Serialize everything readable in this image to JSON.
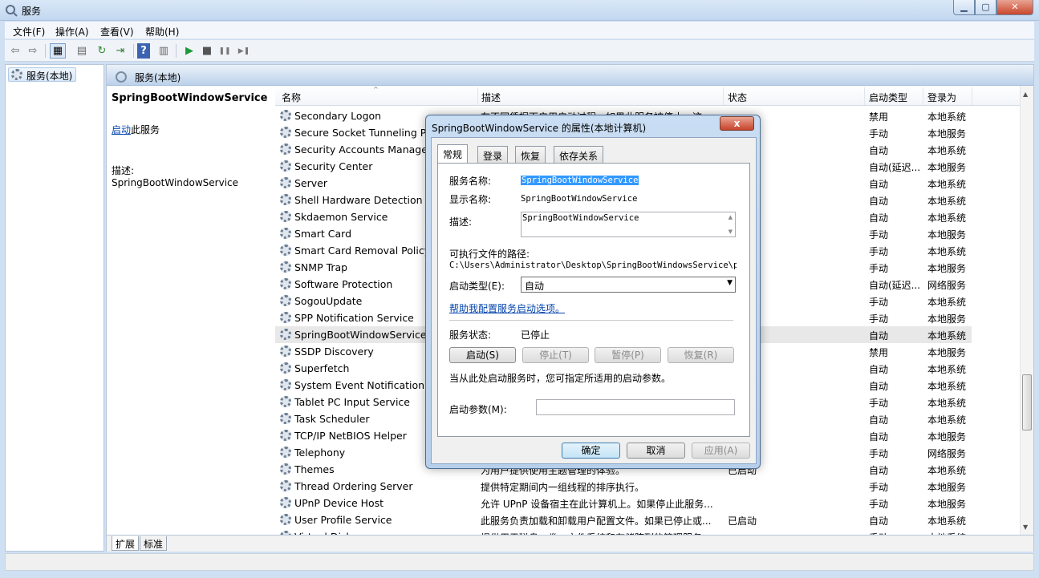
{
  "window": {
    "title": "服务",
    "controls": [
      "minimize",
      "maximize",
      "close"
    ]
  },
  "menu": [
    "文件(F)",
    "操作(A)",
    "查看(V)",
    "帮助(H)"
  ],
  "toolbar": {
    "icons": [
      "back-icon",
      "forward-icon",
      "console-tree-icon",
      "properties-icon",
      "refresh-icon",
      "export-icon",
      "help-icon",
      "view-icon",
      "play-icon",
      "stop-icon",
      "pause-icon",
      "resume-icon"
    ],
    "glyphs": {
      "back": "⇦",
      "forward": "⇨",
      "tree": "▦",
      "props": "▤",
      "refresh": "↻",
      "export": "⇥",
      "help": "?",
      "view": "▥",
      "play": "▶",
      "stop": "■",
      "pause": "❚❚",
      "resume": "▶❚"
    }
  },
  "tree": {
    "node_label": "服务(本地)"
  },
  "pane": {
    "header": "服务(本地)",
    "detail": {
      "service_title": "SpringBootWindowService",
      "start_link": "启动",
      "start_rest": "此服务",
      "desc_label": "描述:",
      "desc_text": "SpringBootWindowService"
    },
    "columns": [
      "名称",
      "描述",
      "状态",
      "启动类型",
      "登录为"
    ],
    "sort_indicator": "^",
    "rows": [
      {
        "name": "Secondary Logon",
        "desc": "在不同凭据下启用启动过程。如果此服务被停止，这...",
        "status": "",
        "type": "禁用",
        "logon": "本地系统"
      },
      {
        "name": "Secure Socket Tunneling Protocol Service",
        "desc": "",
        "status": "",
        "type": "手动",
        "logon": "本地服务"
      },
      {
        "name": "Security Accounts Manager",
        "desc": "",
        "status": "",
        "type": "自动",
        "logon": "本地系统"
      },
      {
        "name": "Security Center",
        "desc": "",
        "status": "",
        "type": "自动(延迟...",
        "logon": "本地服务"
      },
      {
        "name": "Server",
        "desc": "",
        "status": "",
        "type": "自动",
        "logon": "本地系统"
      },
      {
        "name": "Shell Hardware Detection",
        "desc": "",
        "status": "",
        "type": "自动",
        "logon": "本地系统"
      },
      {
        "name": "Skdaemon Service",
        "desc": "",
        "status": "",
        "type": "自动",
        "logon": "本地系统"
      },
      {
        "name": "Smart Card",
        "desc": "",
        "status": "",
        "type": "手动",
        "logon": "本地服务"
      },
      {
        "name": "Smart Card Removal Policy",
        "desc": "",
        "status": "",
        "type": "手动",
        "logon": "本地系统"
      },
      {
        "name": "SNMP Trap",
        "desc": "",
        "status": "",
        "type": "手动",
        "logon": "本地服务"
      },
      {
        "name": "Software Protection",
        "desc": "",
        "status": "",
        "type": "自动(延迟...",
        "logon": "网络服务"
      },
      {
        "name": "SogouUpdate",
        "desc": "",
        "status": "",
        "type": "手动",
        "logon": "本地系统"
      },
      {
        "name": "SPP Notification Service",
        "desc": "",
        "status": "",
        "type": "手动",
        "logon": "本地服务"
      },
      {
        "name": "SpringBootWindowService",
        "desc": "",
        "status": "",
        "type": "自动",
        "logon": "本地系统"
      },
      {
        "name": "SSDP Discovery",
        "desc": "",
        "status": "",
        "type": "禁用",
        "logon": "本地服务"
      },
      {
        "name": "Superfetch",
        "desc": "",
        "status": "",
        "type": "自动",
        "logon": "本地系统"
      },
      {
        "name": "System Event Notification Service",
        "desc": "",
        "status": "",
        "type": "自动",
        "logon": "本地系统"
      },
      {
        "name": "Tablet PC Input Service",
        "desc": "",
        "status": "",
        "type": "手动",
        "logon": "本地系统"
      },
      {
        "name": "Task Scheduler",
        "desc": "",
        "status": "",
        "type": "自动",
        "logon": "本地系统"
      },
      {
        "name": "TCP/IP NetBIOS Helper",
        "desc": "",
        "status": "",
        "type": "自动",
        "logon": "本地服务"
      },
      {
        "name": "Telephony",
        "desc": "",
        "status": "",
        "type": "手动",
        "logon": "网络服务"
      },
      {
        "name": "Themes",
        "desc": "为用户提供使用主题管理的体验。",
        "status": "已启动",
        "type": "自动",
        "logon": "本地系统"
      },
      {
        "name": "Thread Ordering Server",
        "desc": "提供特定期间内一组线程的排序执行。",
        "status": "",
        "type": "手动",
        "logon": "本地服务"
      },
      {
        "name": "UPnP Device Host",
        "desc": "允许 UPnP 设备宿主在此计算机上。如果停止此服务...",
        "status": "",
        "type": "手动",
        "logon": "本地服务"
      },
      {
        "name": "User Profile Service",
        "desc": "此服务负责加载和卸载用户配置文件。如果已停止或...",
        "status": "已启动",
        "type": "自动",
        "logon": "本地系统"
      },
      {
        "name": "Virtual Disk",
        "desc": "提供用于磁盘、卷、文件系统和存储阵列的管理服务。",
        "status": "",
        "type": "手动",
        "logon": "本地系统"
      }
    ],
    "selected_row": 13,
    "bottom_tabs": [
      "扩展",
      "标准"
    ],
    "scroll_up": "▲",
    "scroll_down": "▼"
  },
  "dialog": {
    "title": "SpringBootWindowService 的属性(本地计算机)",
    "close": "x",
    "tabs": [
      "常规",
      "登录",
      "恢复",
      "依存关系"
    ],
    "service_name_label": "服务名称:",
    "service_name_value": "SpringBootWindowService",
    "display_name_label": "显示名称:",
    "display_name_value": "SpringBootWindowService",
    "desc_label": "描述:",
    "desc_value": "SpringBootWindowService",
    "path_label": "可执行文件的路径:",
    "path_value": "C:\\Users\\Administrator\\Desktop\\SpringBootWindowsService\\proc",
    "startup_label": "启动类型(E):",
    "startup_value": "自动",
    "help_link": "帮助我配置服务启动选项。",
    "status_label": "服务状态:",
    "status_value": "已停止",
    "btn_start": "启动(S)",
    "btn_stop": "停止(T)",
    "btn_pause": "暂停(P)",
    "btn_resume": "恢复(R)",
    "params_hint": "当从此处启动服务时，您可指定所适用的启动参数。",
    "params_label": "启动参数(M):",
    "params_value": "",
    "btn_ok": "确定",
    "btn_cancel": "取消",
    "btn_apply": "应用(A)"
  }
}
